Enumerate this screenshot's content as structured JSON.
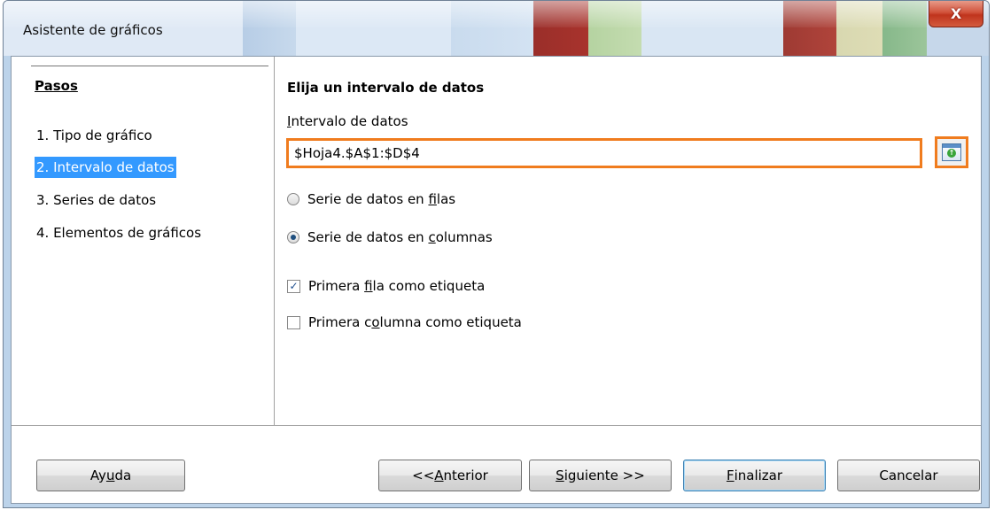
{
  "window": {
    "title": "Asistente de gráficos",
    "close_label": "X"
  },
  "steps": {
    "heading": "Pasos",
    "items": [
      {
        "label": "1. Tipo de gráfico",
        "selected": false
      },
      {
        "label": "2. Intervalo de datos",
        "selected": true
      },
      {
        "label": "3. Series de datos",
        "selected": false
      },
      {
        "label": "4. Elementos de gráficos",
        "selected": false
      }
    ]
  },
  "main": {
    "section_title": "Elija un intervalo de datos",
    "range_label_prefix": "I",
    "range_label_rest": "ntervalo de datos",
    "range_value": "$Hoja4.$A$1:$D$4",
    "options": {
      "rows": {
        "pre": "Serie de datos en ",
        "key": "f",
        "post": "ilas",
        "checked": false
      },
      "columns": {
        "pre": "Serie de datos en ",
        "key": "c",
        "post": "olumnas",
        "checked": true
      },
      "first_row": {
        "pre": "Primera ",
        "key": "f",
        "post": "ila como etiqueta",
        "checked": true
      },
      "first_col": {
        "pre": "Primera c",
        "key": "o",
        "post": "lumna como etiqueta",
        "checked": false
      }
    }
  },
  "footer": {
    "help": {
      "pre": "Ay",
      "key": "u",
      "post": "da"
    },
    "back": {
      "pre": "<< ",
      "key": "A",
      "post": "nterior"
    },
    "next": {
      "pre": "",
      "key": "S",
      "post": "iguiente >>"
    },
    "finish": {
      "pre": "",
      "key": "F",
      "post": "inalizar"
    },
    "cancel": {
      "pre": "Cancelar",
      "key": "",
      "post": ""
    }
  },
  "colors": {
    "highlight_border": "#f07c1e",
    "selection": "#3399ff"
  },
  "icons": {
    "shrink": "shrink-range-icon",
    "close": "close-icon"
  }
}
